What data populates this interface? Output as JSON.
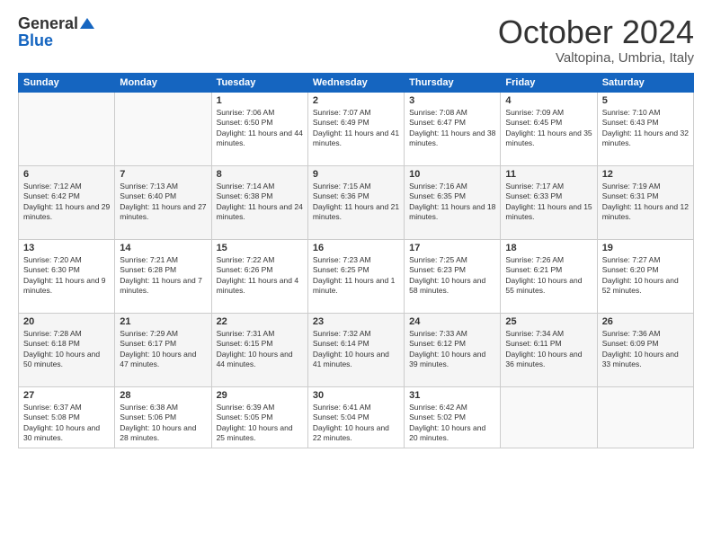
{
  "logo": {
    "general": "General",
    "blue": "Blue"
  },
  "header": {
    "month": "October 2024",
    "location": "Valtopina, Umbria, Italy"
  },
  "weekdays": [
    "Sunday",
    "Monday",
    "Tuesday",
    "Wednesday",
    "Thursday",
    "Friday",
    "Saturday"
  ],
  "weeks": [
    [
      {
        "day": "",
        "sunrise": "",
        "sunset": "",
        "daylight": ""
      },
      {
        "day": "",
        "sunrise": "",
        "sunset": "",
        "daylight": ""
      },
      {
        "day": "1",
        "sunrise": "Sunrise: 7:06 AM",
        "sunset": "Sunset: 6:50 PM",
        "daylight": "Daylight: 11 hours and 44 minutes."
      },
      {
        "day": "2",
        "sunrise": "Sunrise: 7:07 AM",
        "sunset": "Sunset: 6:49 PM",
        "daylight": "Daylight: 11 hours and 41 minutes."
      },
      {
        "day": "3",
        "sunrise": "Sunrise: 7:08 AM",
        "sunset": "Sunset: 6:47 PM",
        "daylight": "Daylight: 11 hours and 38 minutes."
      },
      {
        "day": "4",
        "sunrise": "Sunrise: 7:09 AM",
        "sunset": "Sunset: 6:45 PM",
        "daylight": "Daylight: 11 hours and 35 minutes."
      },
      {
        "day": "5",
        "sunrise": "Sunrise: 7:10 AM",
        "sunset": "Sunset: 6:43 PM",
        "daylight": "Daylight: 11 hours and 32 minutes."
      }
    ],
    [
      {
        "day": "6",
        "sunrise": "Sunrise: 7:12 AM",
        "sunset": "Sunset: 6:42 PM",
        "daylight": "Daylight: 11 hours and 29 minutes."
      },
      {
        "day": "7",
        "sunrise": "Sunrise: 7:13 AM",
        "sunset": "Sunset: 6:40 PM",
        "daylight": "Daylight: 11 hours and 27 minutes."
      },
      {
        "day": "8",
        "sunrise": "Sunrise: 7:14 AM",
        "sunset": "Sunset: 6:38 PM",
        "daylight": "Daylight: 11 hours and 24 minutes."
      },
      {
        "day": "9",
        "sunrise": "Sunrise: 7:15 AM",
        "sunset": "Sunset: 6:36 PM",
        "daylight": "Daylight: 11 hours and 21 minutes."
      },
      {
        "day": "10",
        "sunrise": "Sunrise: 7:16 AM",
        "sunset": "Sunset: 6:35 PM",
        "daylight": "Daylight: 11 hours and 18 minutes."
      },
      {
        "day": "11",
        "sunrise": "Sunrise: 7:17 AM",
        "sunset": "Sunset: 6:33 PM",
        "daylight": "Daylight: 11 hours and 15 minutes."
      },
      {
        "day": "12",
        "sunrise": "Sunrise: 7:19 AM",
        "sunset": "Sunset: 6:31 PM",
        "daylight": "Daylight: 11 hours and 12 minutes."
      }
    ],
    [
      {
        "day": "13",
        "sunrise": "Sunrise: 7:20 AM",
        "sunset": "Sunset: 6:30 PM",
        "daylight": "Daylight: 11 hours and 9 minutes."
      },
      {
        "day": "14",
        "sunrise": "Sunrise: 7:21 AM",
        "sunset": "Sunset: 6:28 PM",
        "daylight": "Daylight: 11 hours and 7 minutes."
      },
      {
        "day": "15",
        "sunrise": "Sunrise: 7:22 AM",
        "sunset": "Sunset: 6:26 PM",
        "daylight": "Daylight: 11 hours and 4 minutes."
      },
      {
        "day": "16",
        "sunrise": "Sunrise: 7:23 AM",
        "sunset": "Sunset: 6:25 PM",
        "daylight": "Daylight: 11 hours and 1 minute."
      },
      {
        "day": "17",
        "sunrise": "Sunrise: 7:25 AM",
        "sunset": "Sunset: 6:23 PM",
        "daylight": "Daylight: 10 hours and 58 minutes."
      },
      {
        "day": "18",
        "sunrise": "Sunrise: 7:26 AM",
        "sunset": "Sunset: 6:21 PM",
        "daylight": "Daylight: 10 hours and 55 minutes."
      },
      {
        "day": "19",
        "sunrise": "Sunrise: 7:27 AM",
        "sunset": "Sunset: 6:20 PM",
        "daylight": "Daylight: 10 hours and 52 minutes."
      }
    ],
    [
      {
        "day": "20",
        "sunrise": "Sunrise: 7:28 AM",
        "sunset": "Sunset: 6:18 PM",
        "daylight": "Daylight: 10 hours and 50 minutes."
      },
      {
        "day": "21",
        "sunrise": "Sunrise: 7:29 AM",
        "sunset": "Sunset: 6:17 PM",
        "daylight": "Daylight: 10 hours and 47 minutes."
      },
      {
        "day": "22",
        "sunrise": "Sunrise: 7:31 AM",
        "sunset": "Sunset: 6:15 PM",
        "daylight": "Daylight: 10 hours and 44 minutes."
      },
      {
        "day": "23",
        "sunrise": "Sunrise: 7:32 AM",
        "sunset": "Sunset: 6:14 PM",
        "daylight": "Daylight: 10 hours and 41 minutes."
      },
      {
        "day": "24",
        "sunrise": "Sunrise: 7:33 AM",
        "sunset": "Sunset: 6:12 PM",
        "daylight": "Daylight: 10 hours and 39 minutes."
      },
      {
        "day": "25",
        "sunrise": "Sunrise: 7:34 AM",
        "sunset": "Sunset: 6:11 PM",
        "daylight": "Daylight: 10 hours and 36 minutes."
      },
      {
        "day": "26",
        "sunrise": "Sunrise: 7:36 AM",
        "sunset": "Sunset: 6:09 PM",
        "daylight": "Daylight: 10 hours and 33 minutes."
      }
    ],
    [
      {
        "day": "27",
        "sunrise": "Sunrise: 6:37 AM",
        "sunset": "Sunset: 5:08 PM",
        "daylight": "Daylight: 10 hours and 30 minutes."
      },
      {
        "day": "28",
        "sunrise": "Sunrise: 6:38 AM",
        "sunset": "Sunset: 5:06 PM",
        "daylight": "Daylight: 10 hours and 28 minutes."
      },
      {
        "day": "29",
        "sunrise": "Sunrise: 6:39 AM",
        "sunset": "Sunset: 5:05 PM",
        "daylight": "Daylight: 10 hours and 25 minutes."
      },
      {
        "day": "30",
        "sunrise": "Sunrise: 6:41 AM",
        "sunset": "Sunset: 5:04 PM",
        "daylight": "Daylight: 10 hours and 22 minutes."
      },
      {
        "day": "31",
        "sunrise": "Sunrise: 6:42 AM",
        "sunset": "Sunset: 5:02 PM",
        "daylight": "Daylight: 10 hours and 20 minutes."
      },
      {
        "day": "",
        "sunrise": "",
        "sunset": "",
        "daylight": ""
      },
      {
        "day": "",
        "sunrise": "",
        "sunset": "",
        "daylight": ""
      }
    ]
  ]
}
